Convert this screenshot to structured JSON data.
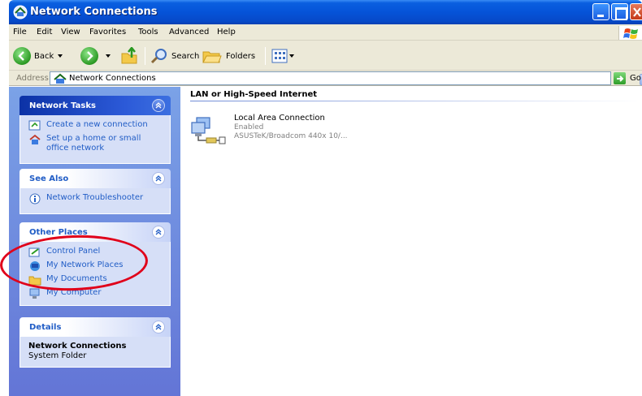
{
  "window": {
    "title": "Network Connections"
  },
  "menu": [
    "File",
    "Edit",
    "View",
    "Favorites",
    "Tools",
    "Advanced",
    "Help"
  ],
  "toolbar": {
    "back": "Back",
    "search": "Search",
    "folders": "Folders"
  },
  "address": {
    "label": "Address",
    "value": "Network Connections",
    "go": "Go"
  },
  "panels": {
    "network_tasks": {
      "title": "Network Tasks",
      "items": [
        "Create a new connection",
        "Set up a home or small office network"
      ]
    },
    "see_also": {
      "title": "See Also",
      "items": [
        "Network Troubleshooter"
      ]
    },
    "other_places": {
      "title": "Other Places",
      "items": [
        "Control Panel",
        "My Network Places",
        "My Documents",
        "My Computer"
      ]
    },
    "details": {
      "title": "Details",
      "name": "Network Connections",
      "sub": "System Folder"
    }
  },
  "content": {
    "group_title": "LAN or High-Speed Internet",
    "connection": {
      "name": "Local Area Connection",
      "status": "Enabled",
      "device": "ASUSTeK/Broadcom 440x 10/..."
    }
  },
  "colors": {
    "title_bar": "#0553d8",
    "task_pane": "#6f8ee0",
    "link": "#215dc6",
    "annotation": "#e0001a"
  }
}
